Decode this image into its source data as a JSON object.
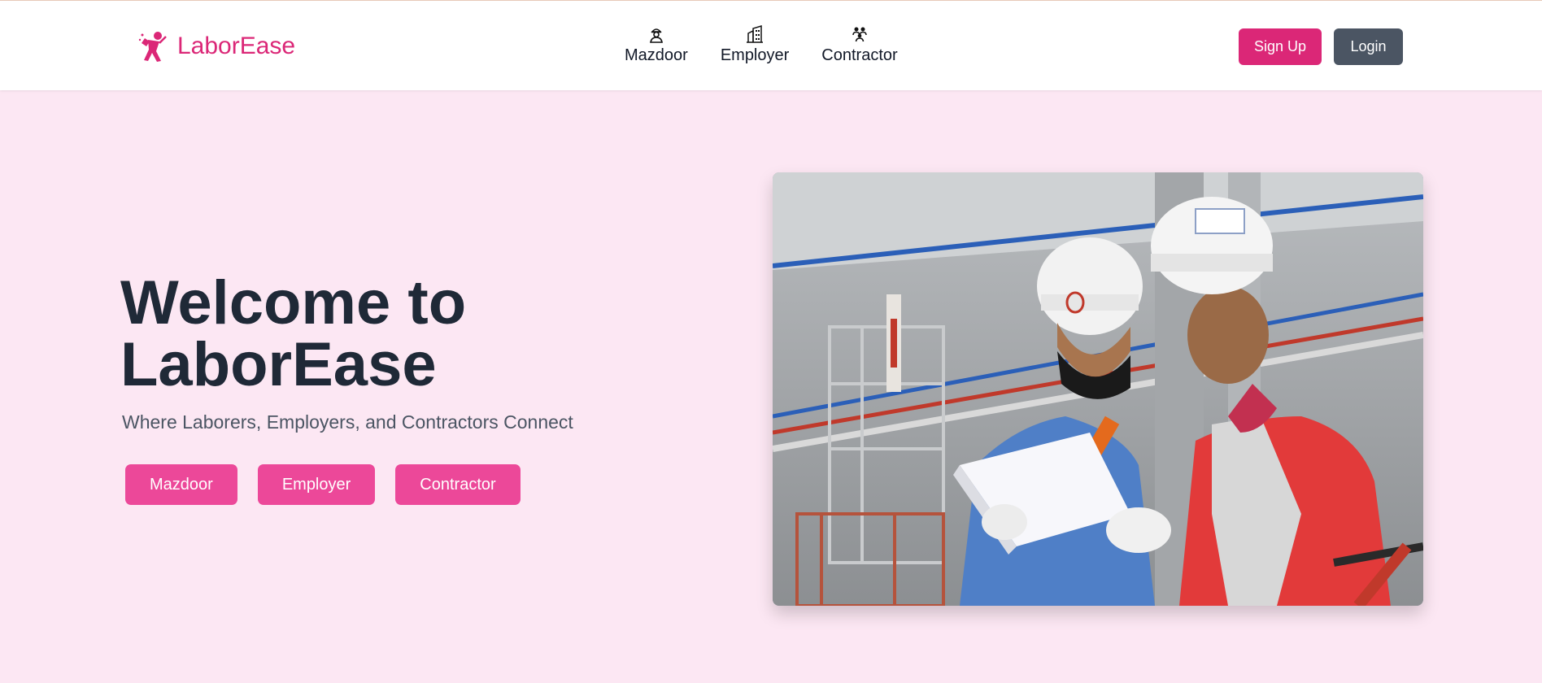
{
  "brand": {
    "name": "LaborEase",
    "icon": "worker-icon",
    "color": "#db2777"
  },
  "nav": {
    "links": [
      {
        "label": "Mazdoor",
        "icon": "laborer-icon"
      },
      {
        "label": "Employer",
        "icon": "building-icon"
      },
      {
        "label": "Contractor",
        "icon": "group-icon"
      }
    ],
    "signup_label": "Sign Up",
    "login_label": "Login"
  },
  "hero": {
    "title_line1": "Welcome to",
    "title_line2": "LaborEase",
    "subtitle": "Where Laborers, Employers, and Contractors Connect",
    "buttons": [
      "Mazdoor",
      "Employer",
      "Contractor"
    ],
    "image_icon": "construction-workers-photo"
  },
  "colors": {
    "accent": "#db2777",
    "button_pink": "#ec4899",
    "login_gray": "#4b5563",
    "background": "#fce7f3"
  }
}
